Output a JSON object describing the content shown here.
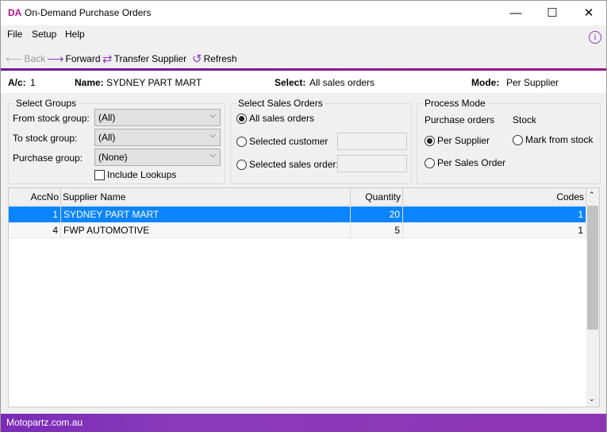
{
  "window": {
    "logo": "DA",
    "title": "On-Demand Purchase Orders",
    "minimize": "—",
    "maximize": "☐",
    "close": "✕"
  },
  "menu": [
    "File",
    "Setup",
    "Help"
  ],
  "toolbar": {
    "back": "Back",
    "forward": "Forward",
    "transfer": "Transfer Supplier",
    "refresh": "Refresh"
  },
  "info": {
    "ac_label": "A/c:",
    "ac_value": "1",
    "name_label": "Name:",
    "name_value": "SYDNEY PART MART",
    "select_label": "Select:",
    "select_value": "All sales orders",
    "mode_label": "Mode:",
    "mode_value": "Per Supplier"
  },
  "groups": {
    "legend": "Select Groups",
    "from_label": "From stock group:",
    "from_value": "(All)",
    "to_label": "To stock group:",
    "to_value": "(All)",
    "purchase_label": "Purchase group:",
    "purchase_value": "(None)",
    "include_lookups": "Include Lookups",
    "include_lookups_checked": false
  },
  "sales": {
    "legend": "Select Sales Orders",
    "all": "All sales orders",
    "customer": "Selected customer",
    "order": "Selected sales order:",
    "selected": "all"
  },
  "process": {
    "legend": "Process Mode",
    "po_label": "Purchase orders",
    "stock_label": "Stock",
    "per_supplier": "Per Supplier",
    "per_sales_order": "Per Sales Order",
    "mark_from_stock": "Mark from stock",
    "selected": "per_supplier"
  },
  "table": {
    "columns": [
      "AccNo",
      "Supplier Name",
      "Quantity",
      "Codes"
    ],
    "rows": [
      {
        "accno": "1",
        "name": "SYDNEY PART MART",
        "quantity": "20",
        "codes": "1",
        "selected": true
      },
      {
        "accno": "4",
        "name": "FWP AUTOMOTIVE",
        "quantity": "5",
        "codes": "1",
        "selected": false
      }
    ]
  },
  "status": {
    "text": "Motopartz.com.au"
  },
  "colors": {
    "accent": "#8a3ab9",
    "selection": "#0a84ff",
    "logo": "#b0168c"
  }
}
